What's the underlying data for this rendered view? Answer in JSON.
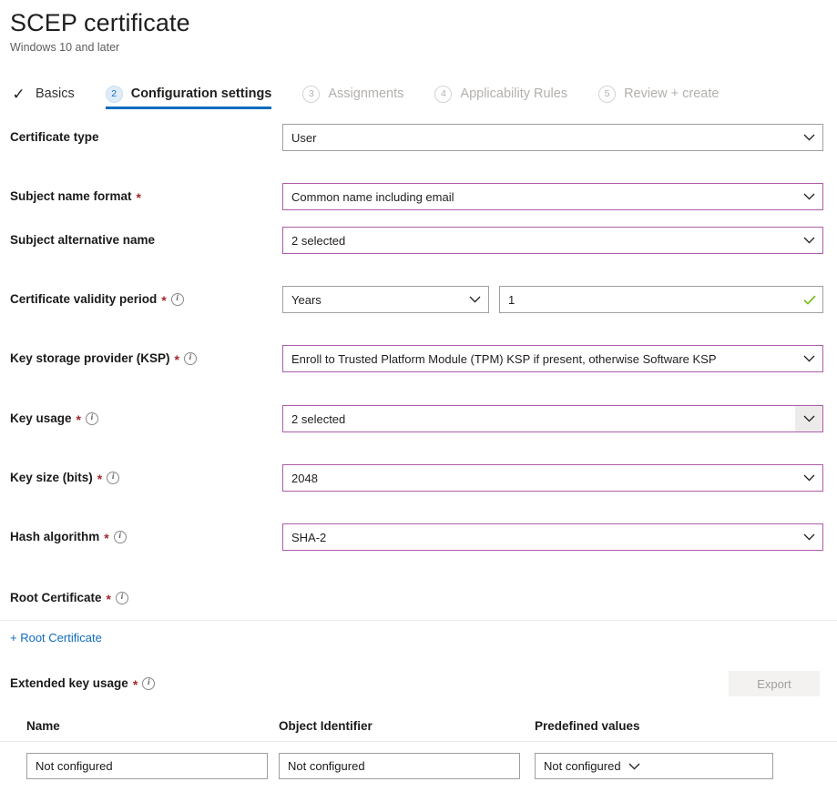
{
  "header": {
    "title": "SCEP certificate",
    "subtitle": "Windows 10 and later"
  },
  "tabs": [
    {
      "label": "Basics",
      "badge": "check",
      "state": "done"
    },
    {
      "label": "Configuration settings",
      "badge": "2",
      "state": "active"
    },
    {
      "label": "Assignments",
      "badge": "3",
      "state": "disabled"
    },
    {
      "label": "Applicability Rules",
      "badge": "4",
      "state": "disabled"
    },
    {
      "label": "Review + create",
      "badge": "5",
      "state": "disabled"
    }
  ],
  "fields": {
    "certificate_type": {
      "label": "Certificate type",
      "value": "User"
    },
    "subject_name_format": {
      "label": "Subject name format",
      "value": "Common name including email"
    },
    "subject_alternative_name": {
      "label": "Subject alternative name",
      "value": "2 selected"
    },
    "certificate_validity_period": {
      "label": "Certificate validity period",
      "unit_value": "Years",
      "number_value": "1"
    },
    "key_storage_provider": {
      "label": "Key storage provider (KSP)",
      "value": "Enroll to Trusted Platform Module (TPM) KSP if present, otherwise Software KSP"
    },
    "key_usage": {
      "label": "Key usage",
      "value": "2 selected"
    },
    "key_size": {
      "label": "Key size (bits)",
      "value": "2048"
    },
    "hash_algorithm": {
      "label": "Hash algorithm",
      "value": "SHA-2"
    },
    "root_certificate": {
      "label": "Root Certificate",
      "add_link": "+ Root Certificate"
    },
    "extended_key_usage": {
      "label": "Extended key usage",
      "export_label": "Export"
    }
  },
  "eku_table": {
    "columns": [
      "Name",
      "Object Identifier",
      "Predefined values"
    ],
    "rows": [
      {
        "name": "Not configured",
        "object_identifier": "Not configured",
        "predefined_values": "Not configured"
      }
    ]
  },
  "symbols": {
    "required": "*",
    "info": "i",
    "checkmark": "✓"
  },
  "colors": {
    "accent_blue": "#0f6cbd",
    "required_red": "#a4262c",
    "modified_purple": "#ae5da8",
    "valid_green": "#6bb700",
    "link_blue": "#0f6cbd"
  }
}
